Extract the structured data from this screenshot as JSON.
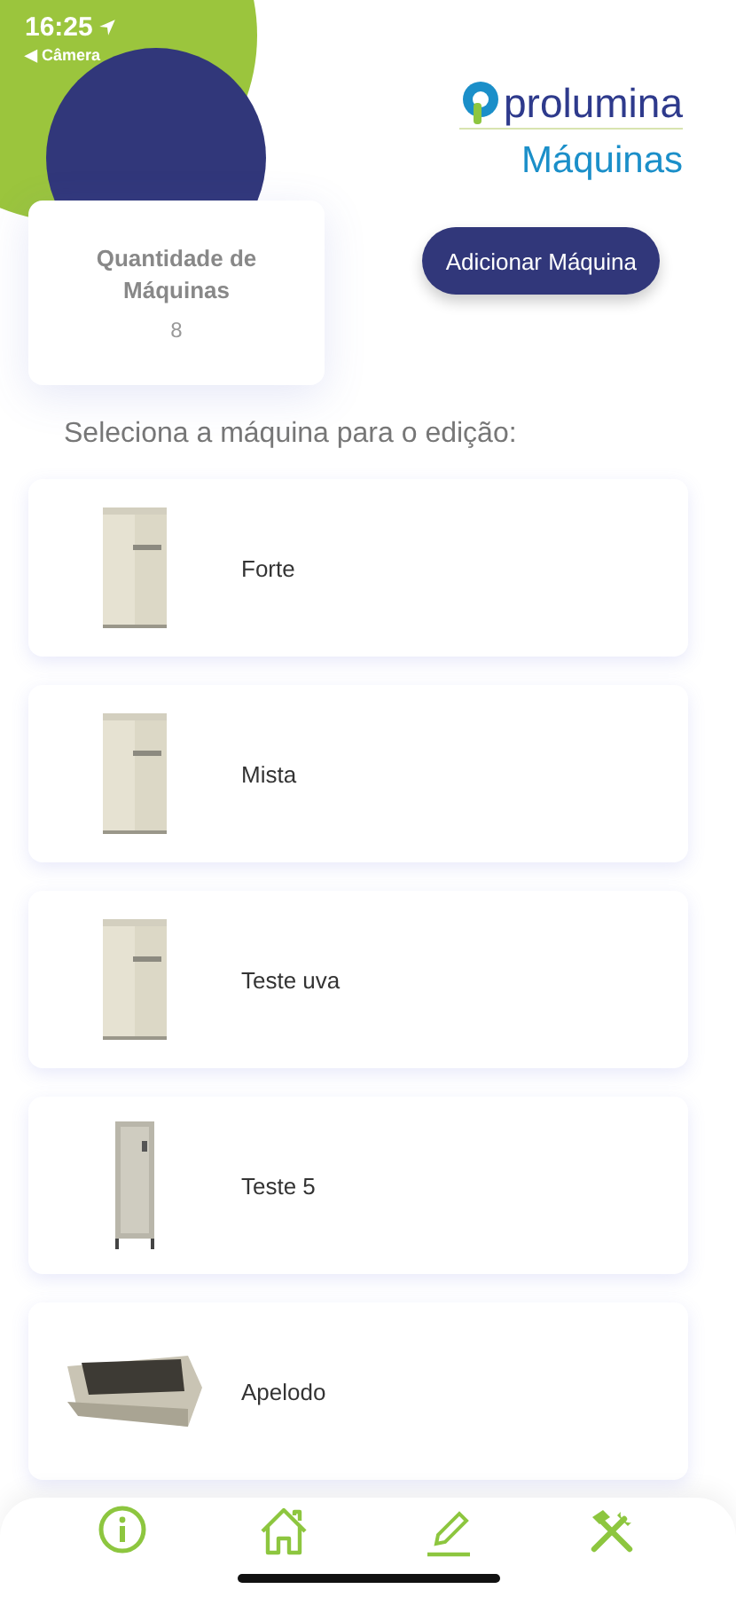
{
  "status_bar": {
    "time": "16:25",
    "back_label": "◀ Câmera"
  },
  "logo": {
    "text": "prolumina"
  },
  "page_title": "Máquinas",
  "summary_card": {
    "label": "Quantidade de Máquinas",
    "value": "8"
  },
  "add_button": "Adicionar Máquina",
  "prompt": "Seleciona a máquina para o edição:",
  "machines": [
    {
      "name": "Forte"
    },
    {
      "name": "Mista"
    },
    {
      "name": "Teste uva"
    },
    {
      "name": "Teste 5"
    },
    {
      "name": "Apelodo"
    }
  ]
}
